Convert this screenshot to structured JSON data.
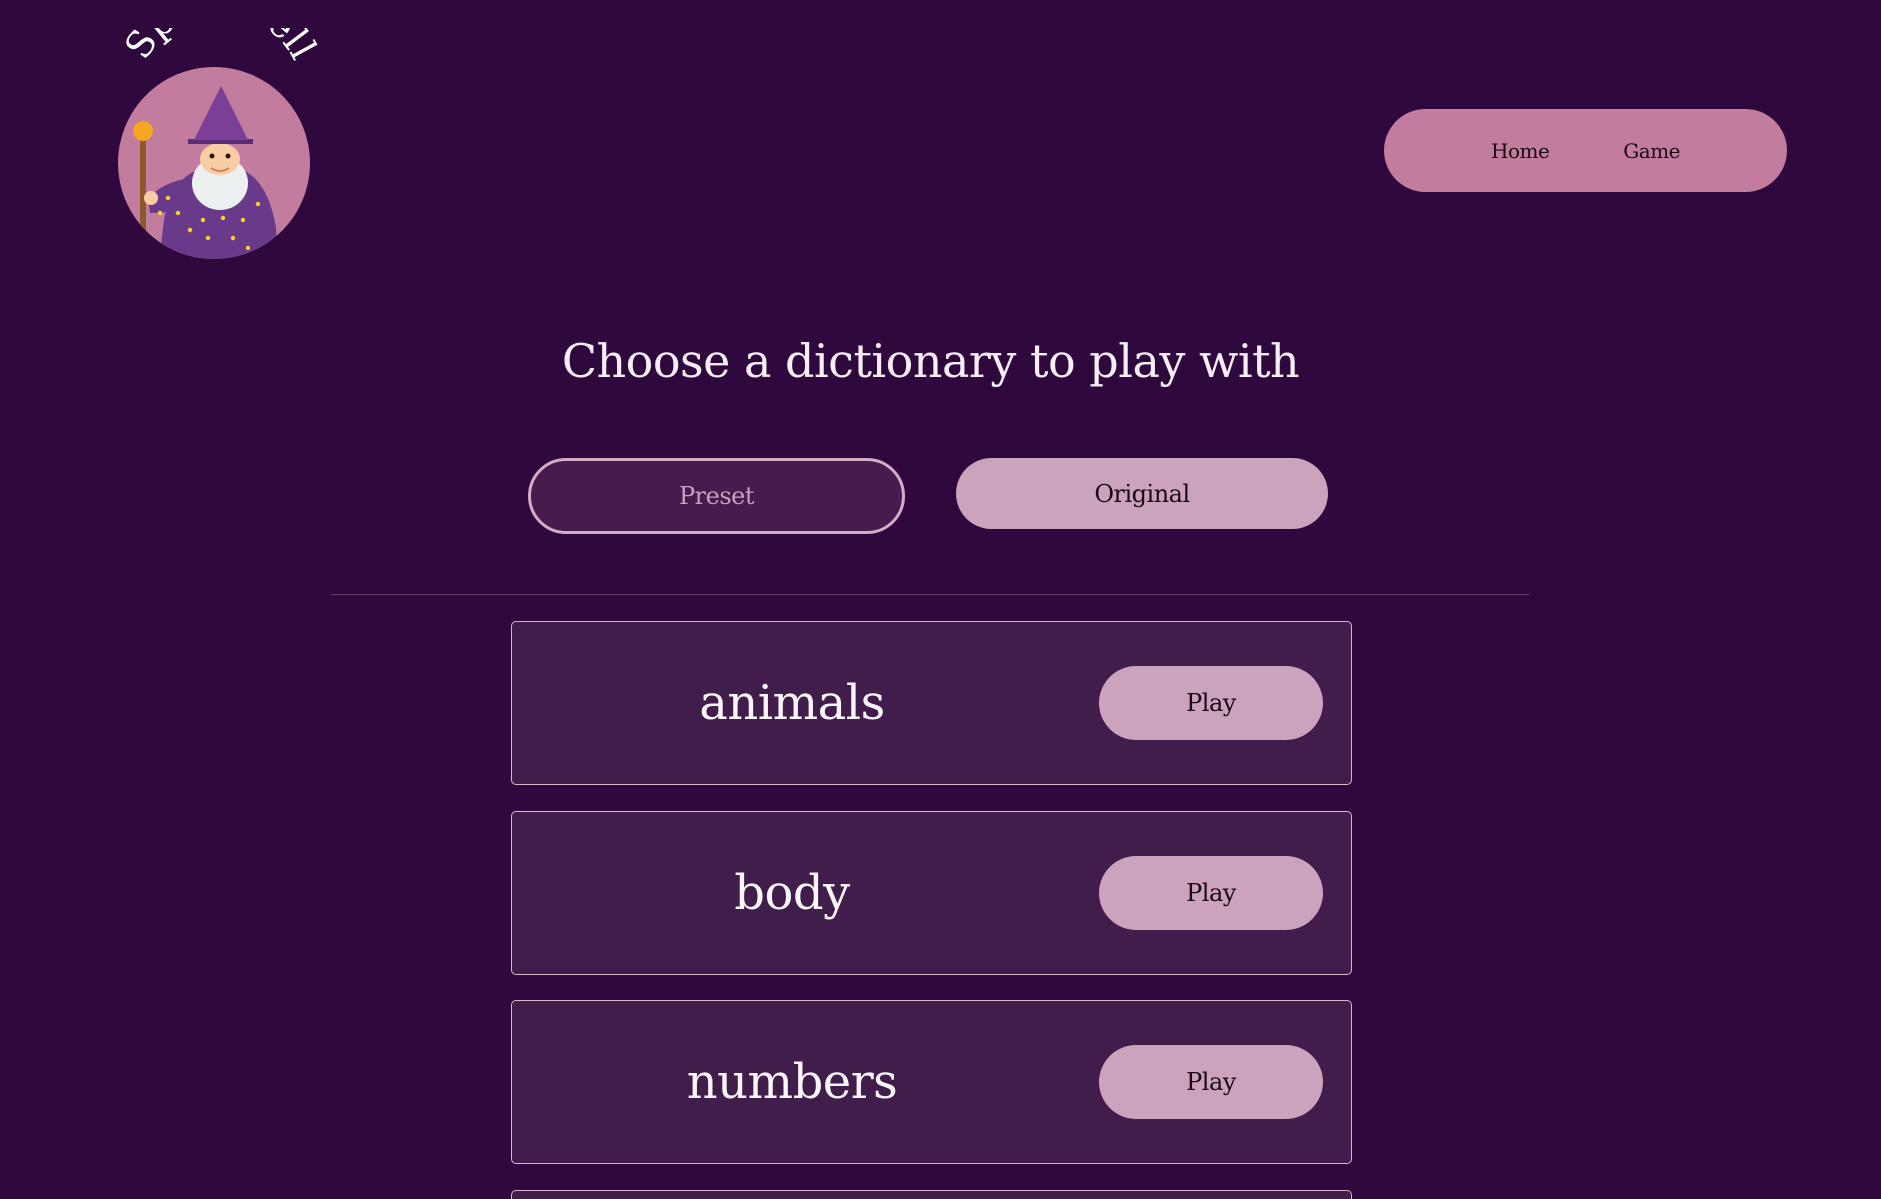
{
  "brand": {
    "logo_text": "Spell Well"
  },
  "nav": {
    "home_label": "Home",
    "game_label": "Game"
  },
  "main": {
    "title": "Choose a dictionary to play with",
    "toggle": {
      "preset_label": "Preset",
      "original_label": "Original",
      "selected": "Preset"
    },
    "dictionaries": [
      {
        "name": "animals",
        "play_label": "Play"
      },
      {
        "name": "body",
        "play_label": "Play"
      },
      {
        "name": "numbers",
        "play_label": "Play"
      },
      {
        "name": "",
        "play_label": ""
      }
    ]
  },
  "colors": {
    "background": "#2f083d",
    "accent_pink": "#c27c9e",
    "button_pink": "#cca3bd",
    "card_bg": "#401d4a",
    "wizard_hat": "#7c3f98",
    "staff_orb": "#f5a623"
  }
}
